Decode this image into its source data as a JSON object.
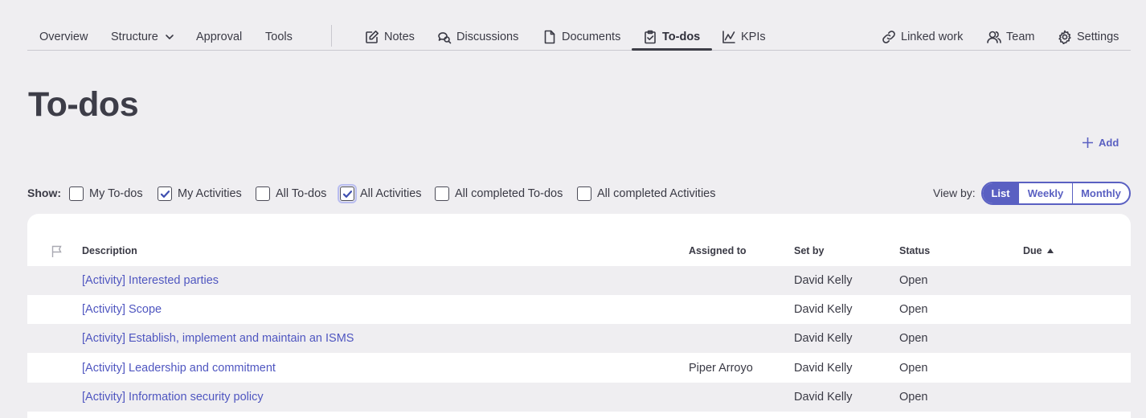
{
  "nav": {
    "left": [
      {
        "label": "Overview"
      },
      {
        "label": "Structure"
      },
      {
        "label": "Approval"
      },
      {
        "label": "Tools"
      }
    ],
    "middle": [
      {
        "label": "Notes",
        "icon": "notes-icon"
      },
      {
        "label": "Discussions",
        "icon": "discussions-icon"
      },
      {
        "label": "Documents",
        "icon": "document-icon"
      },
      {
        "label": "To-dos",
        "icon": "clipboard-check-icon",
        "active": true
      },
      {
        "label": "KPIs",
        "icon": "chart-line-icon"
      }
    ],
    "right": [
      {
        "label": "Linked work",
        "icon": "link-icon"
      },
      {
        "label": "Team",
        "icon": "team-icon"
      },
      {
        "label": "Settings",
        "icon": "gear-icon"
      }
    ]
  },
  "page": {
    "title": "To-dos",
    "add_label": "Add"
  },
  "filters": {
    "show_label": "Show:",
    "options": [
      {
        "label": "My To-dos",
        "checked": false
      },
      {
        "label": "My Activities",
        "checked": true
      },
      {
        "label": "All To-dos",
        "checked": false
      },
      {
        "label": "All Activities",
        "checked": true
      },
      {
        "label": "All completed To-dos",
        "checked": false
      },
      {
        "label": "All completed Activities",
        "checked": false
      }
    ]
  },
  "viewby": {
    "label": "View by:",
    "options": [
      "List",
      "Weekly",
      "Monthly"
    ],
    "selected": "List"
  },
  "table": {
    "headers": {
      "description": "Description",
      "assigned": "Assigned to",
      "setby": "Set by",
      "status": "Status",
      "due": "Due"
    },
    "rows": [
      {
        "description": "[Activity] Interested parties",
        "assigned": "",
        "setby": "David Kelly",
        "status": "Open",
        "due": ""
      },
      {
        "description": "[Activity] Scope",
        "assigned": "",
        "setby": "David Kelly",
        "status": "Open",
        "due": ""
      },
      {
        "description": "[Activity] Establish, implement and maintain an ISMS",
        "assigned": "",
        "setby": "David Kelly",
        "status": "Open",
        "due": ""
      },
      {
        "description": "[Activity] Leadership and commitment",
        "assigned": "Piper Arroyo",
        "setby": "David Kelly",
        "status": "Open",
        "due": ""
      },
      {
        "description": "[Activity] Information security policy",
        "assigned": "",
        "setby": "David Kelly",
        "status": "Open",
        "due": ""
      }
    ]
  },
  "colors": {
    "accent": "#5a60c2",
    "link": "#4f56c0",
    "background": "#efeef1"
  }
}
